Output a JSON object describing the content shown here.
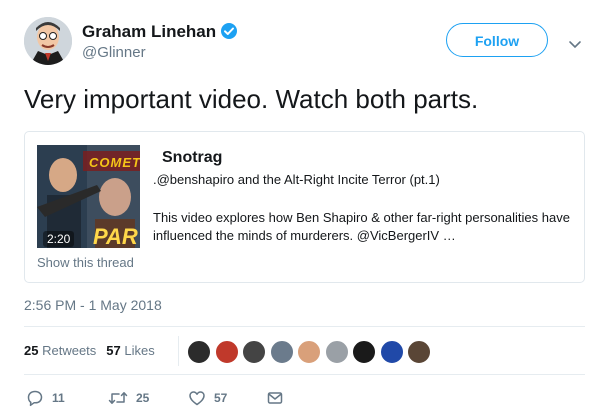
{
  "author": {
    "display_name": "Graham Linehan",
    "handle": "@Glinner",
    "verified": true
  },
  "follow_label": "Follow",
  "tweet_text": "Very important video. Watch both parts.",
  "card": {
    "thumbnail_title_text": "COMET",
    "thumbnail_part_text": "PAR",
    "duration": "2:20",
    "title": "Snotrag",
    "subtitle": ".@benshapiro and the Alt-Right Incite Terror (pt.1)",
    "description": "This video explores how Ben Shapiro & other far-right personalities have influenced the minds of murderers. @VicBergerIV …",
    "show_thread_label": "Show this thread"
  },
  "timestamp": "2:56 PM - 1 May 2018",
  "stats": {
    "retweets_count": "25",
    "retweets_label": "Retweets",
    "likes_count": "57",
    "likes_label": "Likes"
  },
  "liker_avatars": [
    "#2b2b2b",
    "#c0392b",
    "#444444",
    "#6b7b8c",
    "#d9a07a",
    "#9aa0a6",
    "#1a1a1a",
    "#2049a8",
    "#5a4636"
  ],
  "actions": {
    "reply_count": "11",
    "retweet_count": "25",
    "like_count": "57"
  },
  "colors": {
    "accent": "#1da1f2",
    "muted": "#657786",
    "text": "#14171a",
    "border": "#e1e8ed"
  },
  "icons": [
    "verified-badge-icon",
    "chevron-down-icon",
    "reply-icon",
    "retweet-icon",
    "heart-icon",
    "message-icon"
  ]
}
